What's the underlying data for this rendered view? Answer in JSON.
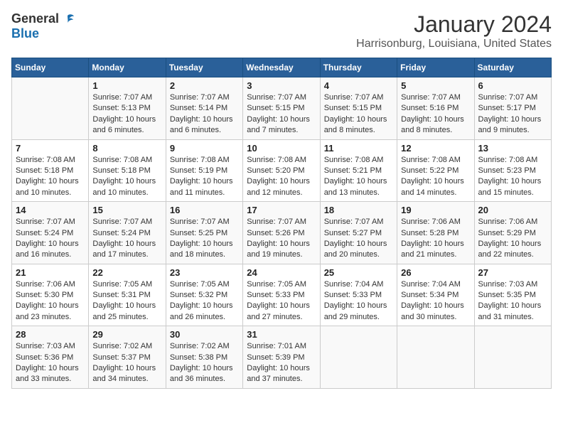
{
  "header": {
    "logo_general": "General",
    "logo_blue": "Blue",
    "title": "January 2024",
    "subtitle": "Harrisonburg, Louisiana, United States"
  },
  "columns": [
    "Sunday",
    "Monday",
    "Tuesday",
    "Wednesday",
    "Thursday",
    "Friday",
    "Saturday"
  ],
  "weeks": [
    [
      {
        "day": "",
        "info": ""
      },
      {
        "day": "1",
        "info": "Sunrise: 7:07 AM\nSunset: 5:13 PM\nDaylight: 10 hours\nand 6 minutes."
      },
      {
        "day": "2",
        "info": "Sunrise: 7:07 AM\nSunset: 5:14 PM\nDaylight: 10 hours\nand 6 minutes."
      },
      {
        "day": "3",
        "info": "Sunrise: 7:07 AM\nSunset: 5:15 PM\nDaylight: 10 hours\nand 7 minutes."
      },
      {
        "day": "4",
        "info": "Sunrise: 7:07 AM\nSunset: 5:15 PM\nDaylight: 10 hours\nand 8 minutes."
      },
      {
        "day": "5",
        "info": "Sunrise: 7:07 AM\nSunset: 5:16 PM\nDaylight: 10 hours\nand 8 minutes."
      },
      {
        "day": "6",
        "info": "Sunrise: 7:07 AM\nSunset: 5:17 PM\nDaylight: 10 hours\nand 9 minutes."
      }
    ],
    [
      {
        "day": "7",
        "info": "Sunrise: 7:08 AM\nSunset: 5:18 PM\nDaylight: 10 hours\nand 10 minutes."
      },
      {
        "day": "8",
        "info": "Sunrise: 7:08 AM\nSunset: 5:18 PM\nDaylight: 10 hours\nand 10 minutes."
      },
      {
        "day": "9",
        "info": "Sunrise: 7:08 AM\nSunset: 5:19 PM\nDaylight: 10 hours\nand 11 minutes."
      },
      {
        "day": "10",
        "info": "Sunrise: 7:08 AM\nSunset: 5:20 PM\nDaylight: 10 hours\nand 12 minutes."
      },
      {
        "day": "11",
        "info": "Sunrise: 7:08 AM\nSunset: 5:21 PM\nDaylight: 10 hours\nand 13 minutes."
      },
      {
        "day": "12",
        "info": "Sunrise: 7:08 AM\nSunset: 5:22 PM\nDaylight: 10 hours\nand 14 minutes."
      },
      {
        "day": "13",
        "info": "Sunrise: 7:08 AM\nSunset: 5:23 PM\nDaylight: 10 hours\nand 15 minutes."
      }
    ],
    [
      {
        "day": "14",
        "info": "Sunrise: 7:07 AM\nSunset: 5:24 PM\nDaylight: 10 hours\nand 16 minutes."
      },
      {
        "day": "15",
        "info": "Sunrise: 7:07 AM\nSunset: 5:24 PM\nDaylight: 10 hours\nand 17 minutes."
      },
      {
        "day": "16",
        "info": "Sunrise: 7:07 AM\nSunset: 5:25 PM\nDaylight: 10 hours\nand 18 minutes."
      },
      {
        "day": "17",
        "info": "Sunrise: 7:07 AM\nSunset: 5:26 PM\nDaylight: 10 hours\nand 19 minutes."
      },
      {
        "day": "18",
        "info": "Sunrise: 7:07 AM\nSunset: 5:27 PM\nDaylight: 10 hours\nand 20 minutes."
      },
      {
        "day": "19",
        "info": "Sunrise: 7:06 AM\nSunset: 5:28 PM\nDaylight: 10 hours\nand 21 minutes."
      },
      {
        "day": "20",
        "info": "Sunrise: 7:06 AM\nSunset: 5:29 PM\nDaylight: 10 hours\nand 22 minutes."
      }
    ],
    [
      {
        "day": "21",
        "info": "Sunrise: 7:06 AM\nSunset: 5:30 PM\nDaylight: 10 hours\nand 23 minutes."
      },
      {
        "day": "22",
        "info": "Sunrise: 7:05 AM\nSunset: 5:31 PM\nDaylight: 10 hours\nand 25 minutes."
      },
      {
        "day": "23",
        "info": "Sunrise: 7:05 AM\nSunset: 5:32 PM\nDaylight: 10 hours\nand 26 minutes."
      },
      {
        "day": "24",
        "info": "Sunrise: 7:05 AM\nSunset: 5:33 PM\nDaylight: 10 hours\nand 27 minutes."
      },
      {
        "day": "25",
        "info": "Sunrise: 7:04 AM\nSunset: 5:33 PM\nDaylight: 10 hours\nand 29 minutes."
      },
      {
        "day": "26",
        "info": "Sunrise: 7:04 AM\nSunset: 5:34 PM\nDaylight: 10 hours\nand 30 minutes."
      },
      {
        "day": "27",
        "info": "Sunrise: 7:03 AM\nSunset: 5:35 PM\nDaylight: 10 hours\nand 31 minutes."
      }
    ],
    [
      {
        "day": "28",
        "info": "Sunrise: 7:03 AM\nSunset: 5:36 PM\nDaylight: 10 hours\nand 33 minutes."
      },
      {
        "day": "29",
        "info": "Sunrise: 7:02 AM\nSunset: 5:37 PM\nDaylight: 10 hours\nand 34 minutes."
      },
      {
        "day": "30",
        "info": "Sunrise: 7:02 AM\nSunset: 5:38 PM\nDaylight: 10 hours\nand 36 minutes."
      },
      {
        "day": "31",
        "info": "Sunrise: 7:01 AM\nSunset: 5:39 PM\nDaylight: 10 hours\nand 37 minutes."
      },
      {
        "day": "",
        "info": ""
      },
      {
        "day": "",
        "info": ""
      },
      {
        "day": "",
        "info": ""
      }
    ]
  ]
}
